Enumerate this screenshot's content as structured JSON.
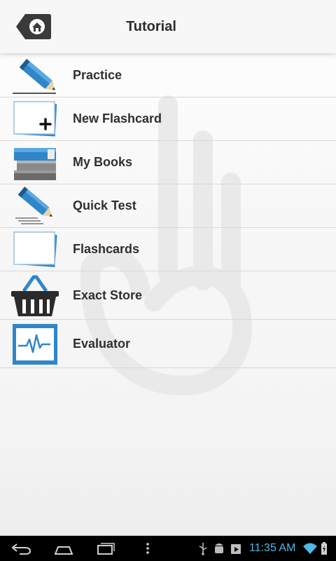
{
  "header": {
    "title": "Tutorial",
    "home_icon": "home-icon"
  },
  "menu": {
    "items": [
      {
        "label": "Practice",
        "icon": "pencil-icon"
      },
      {
        "label": "New Flashcard",
        "icon": "new-flashcard-icon"
      },
      {
        "label": "My Books",
        "icon": "books-icon"
      },
      {
        "label": "Quick Test",
        "icon": "pencil-lines-icon"
      },
      {
        "label": "Flashcards",
        "icon": "flashcards-icon"
      },
      {
        "label": "Exact Store",
        "icon": "basket-icon"
      },
      {
        "label": "Evaluator",
        "icon": "monitor-pulse-icon"
      }
    ]
  },
  "statusbar": {
    "time": "11:35 AM"
  },
  "colors": {
    "accent_blue": "#2f86c8",
    "clock_blue": "#4fb7e8",
    "text_dark": "#2f2f2f"
  }
}
